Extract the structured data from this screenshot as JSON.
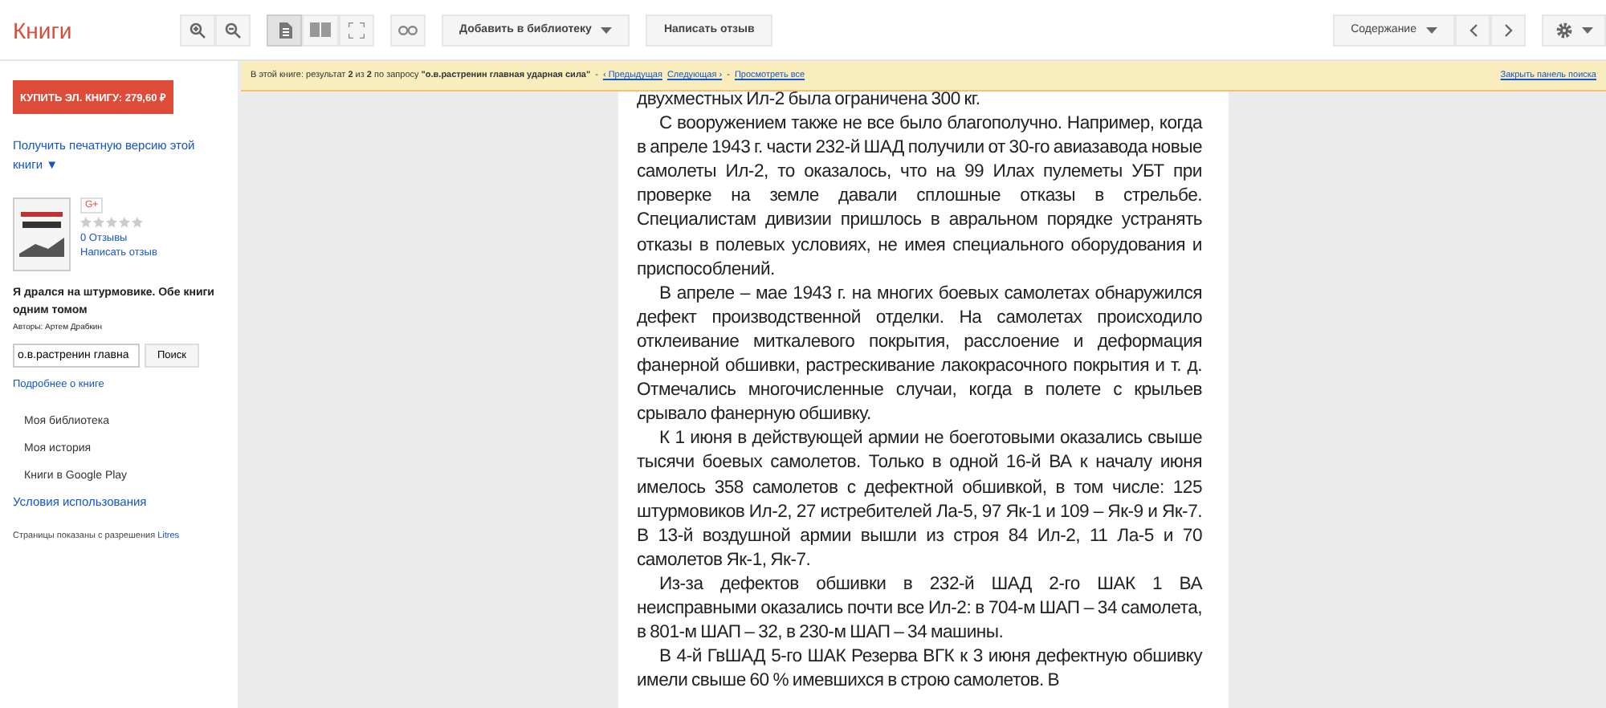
{
  "header": {
    "logo": "Книги",
    "view_modes": [
      {
        "kind": "single",
        "selected": true
      },
      {
        "kind": "double",
        "selected": false
      },
      {
        "kind": "fullscreen",
        "selected": false
      }
    ],
    "add_to_library": "Добавить в библиотеку",
    "write_review": "Написать отзыв",
    "contents": "Содержание"
  },
  "sidebar": {
    "buy_button": "КУПИТЬ ЭЛ. КНИГУ: 279,60 ₽",
    "print_version": "Получить печатную версию этой книги ▼",
    "gplus": "G+",
    "stars": 0,
    "reviews": "0 Отзывы",
    "write_review": "Написать отзыв",
    "book_title": "Я дрался на штурмовике. Обе книги одним томом",
    "authors": "Авторы: Артем Драбкин",
    "search_value": "о.в.растренин главна",
    "search_button": "Поиск",
    "about": "Подробнее о книге",
    "nav": [
      {
        "label": "Моя библиотека"
      },
      {
        "label": "Моя история"
      },
      {
        "label": "Книги в Google Play"
      }
    ],
    "terms": "Условия использования",
    "permission": "Страницы показаны с разрешения ",
    "publisher": "Litres"
  },
  "search_bar": {
    "prefix": "В этой книге: результат ",
    "current": "2",
    "of": " из ",
    "total": "2",
    "query_prefix": " по запросу ",
    "query": "\"о.в.растренин главная ударная сила\"",
    "separator": "-",
    "previous": "‹ Предыдущая",
    "next": "Следующая ›",
    "view_all": "Просмотреть все",
    "close": "Закрыть панель поиска"
  },
  "page": {
    "paragraphs": [
      {
        "text": "двухместных Ил-2 была ограничена 300 кг.",
        "indent": false
      },
      {
        "text": "С вооружением также не все было благополучно. Например, когда в апреле 1943 г. части 232-й ШАД получили от 30-го авиазавода новые самолеты Ил-2, то оказалось, что на 99 Илах пулеметы УБТ при проверке на земле давали сплошные отказы в стрельбе. Специалистам дивизии пришлось в авральном порядке устранять отказы в полевых условиях, не имея специального оборудования и приспособлений.",
        "indent": true
      },
      {
        "text": "В апреле – мае 1943 г. на многих боевых самолетах обнаружился дефект производственной отделки. На самолетах происходило отклеивание миткалевого покрытия, расслоение и деформация фанерной обшивки, растрескивание лакокрасочного покрытия и т. д. Отмечались многочисленные случаи, когда в полете с крыльев срывало фанерную обшивку.",
        "indent": true
      },
      {
        "text": "К 1 июня в действующей армии не боеготовыми оказались свыше тысячи боевых самолетов. Только в одной 16-й ВА к началу июня имелось 358 самолетов с дефектной обшивкой, в том числе: 125 штурмовиков Ил-2, 27 истребителей Ла-5, 97 Як-1 и 109 – Як-9 и Як-7. В 13-й воздушной армии вышли из строя 84 Ил-2, 11 Ла-5 и 70 самолетов Як-1, Як-7.",
        "indent": true
      },
      {
        "text": "Из-за дефектов обшивки в 232-й ШАД 2-го ШАК 1 ВА неисправными оказались почти все Ил-2: в 704-м ШАП – 34 самолета, в 801-м ШАП – 32, в 230-м ШАП – 34 машины.",
        "indent": true
      },
      {
        "text": "В 4-й ГвШАД 5-го ШАК Резерва ВГК к 3 июня дефектную обшивку имели свыше 60 % имевшихся в строю самолетов. В",
        "indent": true
      }
    ]
  }
}
